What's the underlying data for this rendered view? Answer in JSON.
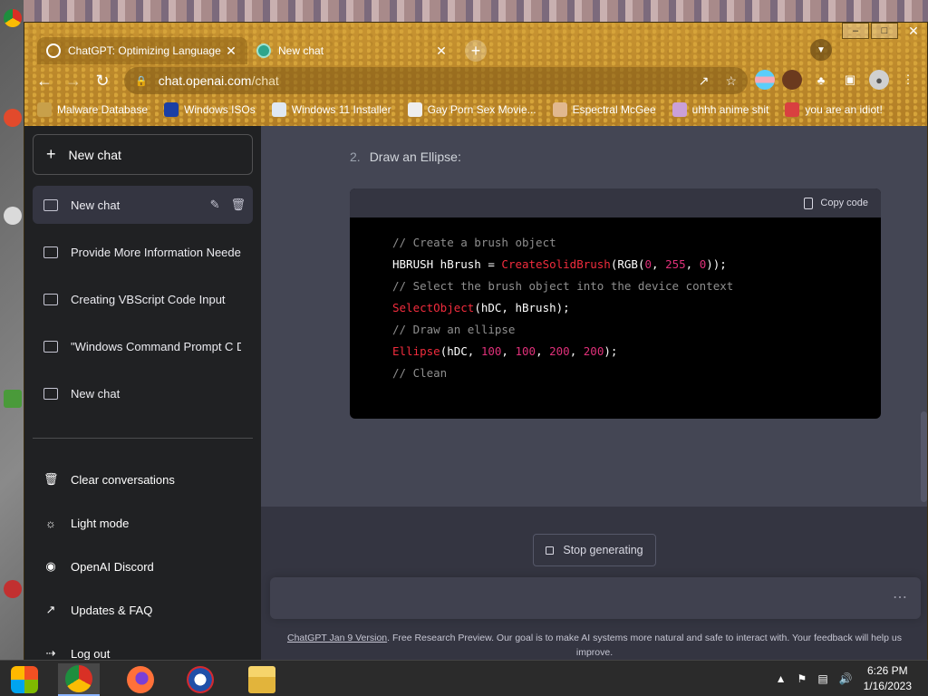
{
  "browser": {
    "tabs": [
      {
        "title": "ChatGPT: Optimizing Language M",
        "active": true
      },
      {
        "title": "New chat",
        "active": false
      }
    ],
    "url_host": "chat.openai.com",
    "url_path": "/chat",
    "bookmarks": [
      {
        "label": "Malware Database",
        "color": "#c8a04a"
      },
      {
        "label": "Windows ISOs",
        "color": "#1b3fa5"
      },
      {
        "label": "Windows 11 Installer",
        "color": "#dfe8f2"
      },
      {
        "label": "Gay Porn Sex Movie...",
        "color": "#eeeeee"
      },
      {
        "label": "Espectral McGee",
        "color": "#e1b88f"
      },
      {
        "label": "uhhh anime shit",
        "color": "#caa0d8"
      },
      {
        "label": "you are an idiot!",
        "color": "#d94040"
      }
    ]
  },
  "sidebar": {
    "new_chat_label": "New chat",
    "conversations": [
      {
        "label": "New chat"
      },
      {
        "label": "Provide More Information Neede"
      },
      {
        "label": "Creating VBScript Code Input"
      },
      {
        "label": "\"Windows Command Prompt C D"
      },
      {
        "label": "New chat"
      }
    ],
    "menu": [
      {
        "label": "Clear conversations",
        "icon": "trash-icon"
      },
      {
        "label": "Light mode",
        "icon": "sun-icon"
      },
      {
        "label": "OpenAI Discord",
        "icon": "discord-icon"
      },
      {
        "label": "Updates & FAQ",
        "icon": "external-link-icon"
      },
      {
        "label": "Log out",
        "icon": "logout-icon"
      }
    ]
  },
  "main": {
    "list_number": "2.",
    "list_text": "Draw an Ellipse:",
    "copy_code_label": "Copy code",
    "code_lines": [
      "// Create a brush object",
      "HBRUSH hBrush = CreateSolidBrush(RGB(0, 255, 0));",
      "// Select the brush object into the device context",
      "SelectObject(hDC, hBrush);",
      "// Draw an ellipse",
      "Ellipse(hDC, 100, 100, 200, 200);",
      "// Clean"
    ],
    "stop_label": "Stop generating",
    "disclaimer_link": "ChatGPT Jan 9 Version",
    "disclaimer_text": ". Free Research Preview. Our goal is to make AI systems more natural and safe to interact with. Your feedback will help us improve.",
    "prompt_placeholder": ""
  },
  "taskbar": {
    "time": "6:26 PM",
    "date": "1/16/2023"
  },
  "colors": {
    "sidebar_bg": "#202123",
    "main_bg": "#444654",
    "code_bg": "#000000",
    "accent_fn": "#f22c3d",
    "accent_num": "#df3079"
  }
}
